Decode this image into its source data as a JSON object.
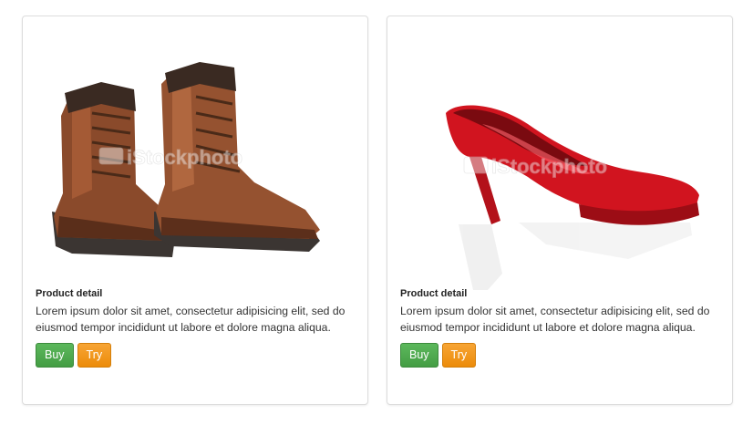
{
  "products": [
    {
      "image": {
        "icon": "brown-boots-image",
        "watermark": "iStockphoto"
      },
      "title": "Product detail",
      "description": "Lorem ipsum dolor sit amet, consectetur adipisicing elit, sed do eiusmod tempor incididunt ut labore et dolore magna aliqua.",
      "buy_label": "Buy",
      "try_label": "Try"
    },
    {
      "image": {
        "icon": "red-high-heel-image",
        "watermark": "iStockphoto"
      },
      "title": "Product detail",
      "description": "Lorem ipsum dolor sit amet, consectetur adipisicing elit, sed do eiusmod tempor incididunt ut labore et dolore magna aliqua.",
      "buy_label": "Buy",
      "try_label": "Try"
    }
  ],
  "colors": {
    "buy": "#5cb85c",
    "try": "#f0932b",
    "border": "#dddddd"
  }
}
